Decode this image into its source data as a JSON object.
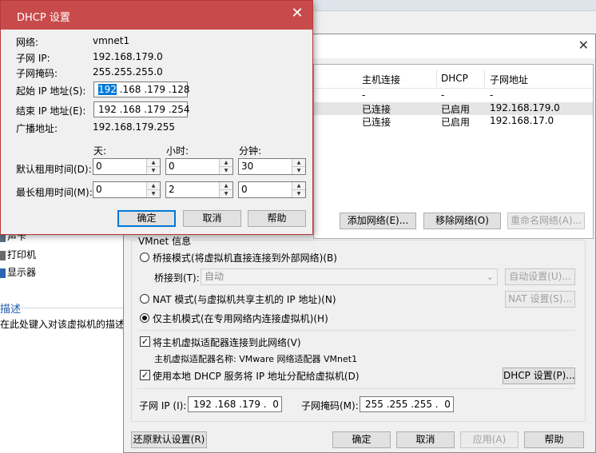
{
  "background": {
    "tab_fragment_1": "主页",
    "tab_fragment_2": "ordubuntu",
    "left_panel": {
      "items": [
        "声卡",
        "打印机",
        "显示器"
      ],
      "description_heading": "描述",
      "description_text": "在此处键入对该虚拟机的描述。"
    },
    "network_list": {
      "headers": [
        "主机连接",
        "DHCP",
        "子网地址"
      ],
      "rows": [
        {
          "host": "-",
          "dhcp": "-",
          "subnet": "-"
        },
        {
          "host": "已连接",
          "dhcp": "已启用",
          "subnet": "192.168.179.0"
        },
        {
          "host": "已连接",
          "dhcp": "已启用",
          "subnet": "192.168.17.0"
        }
      ]
    },
    "buttons": {
      "add_network": "添加网络(E)...",
      "remove_network": "移除网络(O)",
      "rename_network": "重命名网络(A)..."
    },
    "vmnet_info": {
      "title": "VMnet 信息",
      "bridged": "桥接模式(将虚拟机直接连接到外部网络)(B)",
      "bridged_to_label": "桥接到(T):",
      "bridged_to_value": "自动",
      "auto_settings": "自动设置(U)...",
      "nat": "NAT 模式(与虚拟机共享主机的 IP 地址)(N)",
      "nat_settings": "NAT 设置(S)...",
      "host_only": "仅主机模式(在专用网络内连接虚拟机)(H)",
      "connect_host_adapter": "将主机虚拟适配器连接到此网络(V)",
      "adapter_name": "主机虚拟适配器名称: VMware 网络适配器 VMnet1",
      "use_dhcp": "使用本地 DHCP 服务将 IP 地址分配给虚拟机(D)",
      "dhcp_settings": "DHCP 设置(P)...",
      "subnet_ip_label": "子网 IP (I):",
      "subnet_ip": "192 .168 .179 .  0",
      "subnet_mask_label": "子网掩码(M):",
      "subnet_mask": "255 .255 .255 .  0"
    },
    "footer": {
      "restore": "还原默认设置(R)",
      "ok": "确定",
      "cancel": "取消",
      "apply": "应用(A)",
      "help": "帮助"
    }
  },
  "dhcp_dialog": {
    "title": "DHCP 设置",
    "network_label": "网络:",
    "network_value": "vmnet1",
    "subnet_ip_label": "子网 IP:",
    "subnet_ip_value": "192.168.179.0",
    "subnet_mask_label": "子网掩码:",
    "subnet_mask_value": "255.255.255.0",
    "start_ip_label": "起始 IP 地址(S):",
    "start_ip_first": "192",
    "start_ip_rest": " .168 .179 .128",
    "end_ip_label": "结束 IP 地址(E):",
    "end_ip_value": "192 .168 .179 .254",
    "broadcast_label": "广播地址:",
    "broadcast_value": "192.168.179.255",
    "col_days": "天:",
    "col_hours": "小时:",
    "col_minutes": "分钟:",
    "default_lease_label": "默认租用时间(D):",
    "default_lease": {
      "days": "0",
      "hours": "0",
      "minutes": "30"
    },
    "max_lease_label": "最长租用时间(M):",
    "max_lease": {
      "days": "0",
      "hours": "2",
      "minutes": "0"
    },
    "ok": "确定",
    "cancel": "取消",
    "help": "帮助"
  }
}
